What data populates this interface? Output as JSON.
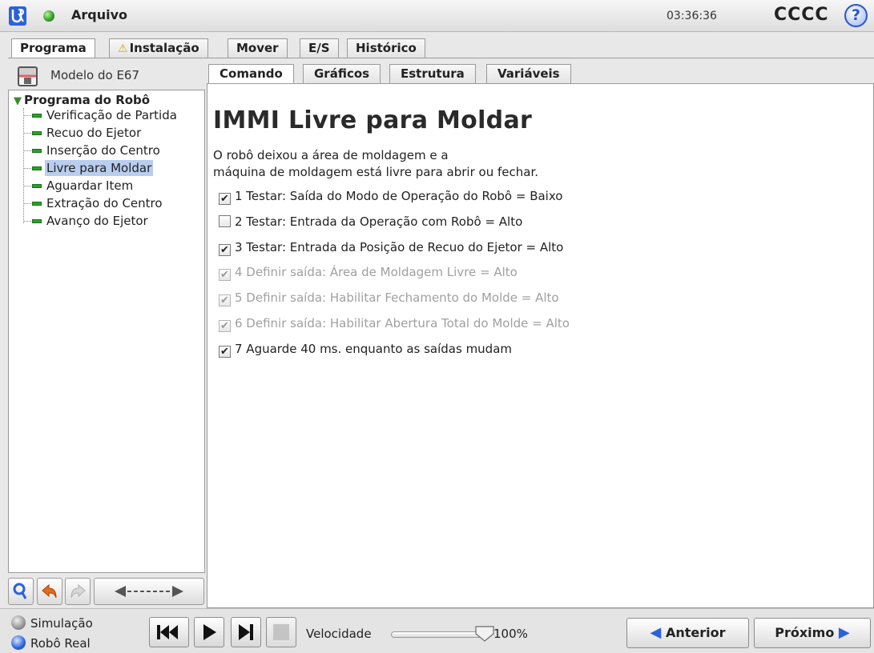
{
  "topbar": {
    "file_menu": "Arquivo",
    "clock": "03:36:36",
    "robot_name": "CCCC",
    "help_label": "?"
  },
  "main_tabs": [
    {
      "label": "Programa",
      "active": true
    },
    {
      "label": "Instalação",
      "active": false,
      "icon": "warning-icon"
    },
    {
      "label": "Mover",
      "active": false
    },
    {
      "label": "E/S",
      "active": false
    },
    {
      "label": "Histórico",
      "active": false
    }
  ],
  "program": {
    "name": "Modelo do E67",
    "tree": {
      "root": "Programa do Robô",
      "items": [
        {
          "label": "Verificação de Partida",
          "selected": false
        },
        {
          "label": "Recuo do Ejetor",
          "selected": false
        },
        {
          "label": "Inserção do Centro",
          "selected": false
        },
        {
          "label": "Livre para Moldar",
          "selected": true
        },
        {
          "label": "Aguardar Item",
          "selected": false
        },
        {
          "label": "Extração do Centro",
          "selected": false
        },
        {
          "label": "Avanço do Ejetor",
          "selected": false
        }
      ]
    }
  },
  "sub_tabs": [
    {
      "label": "Comando",
      "active": true
    },
    {
      "label": "Gráficos",
      "active": false
    },
    {
      "label": "Estrutura",
      "active": false
    },
    {
      "label": "Variáveis",
      "active": false
    }
  ],
  "command": {
    "title": "IMMI Livre para Moldar",
    "description_line1": "O robô deixou a área de moldagem e a",
    "description_line2": "máquina de moldagem está livre para abrir ou fechar.",
    "checks": [
      {
        "label": "1 Testar: Saída do Modo de Operação do Robô = Baixo",
        "checked": true,
        "enabled": true
      },
      {
        "label": "2 Testar: Entrada da Operação com Robô = Alto",
        "checked": false,
        "enabled": true
      },
      {
        "label": "3 Testar: Entrada da Posição de Recuo do Ejetor = Alto",
        "checked": true,
        "enabled": true
      },
      {
        "label": "4 Definir saída: Área de Moldagem Livre = Alto",
        "checked": true,
        "enabled": false
      },
      {
        "label": "5 Definir saída: Habilitar Fechamento do Molde = Alto",
        "checked": true,
        "enabled": false
      },
      {
        "label": "6 Definir saída: Habilitar Abertura Total do Molde = Alto",
        "checked": true,
        "enabled": false
      },
      {
        "label": "7 Aguarde 40 ms. enquanto as saídas mudam",
        "checked": true,
        "enabled": true
      }
    ]
  },
  "bottombar": {
    "mode_simulation": "Simulação",
    "mode_real": "Robô Real",
    "speed_label": "Velocidade",
    "speed_value": "100%",
    "speed_fraction": 1.0,
    "prev_label": "Anterior",
    "next_label": "Próximo"
  },
  "colors": {
    "accent_blue": "#2b62d9",
    "status_green": "#2f9a20",
    "selection": "#b9cdef"
  }
}
